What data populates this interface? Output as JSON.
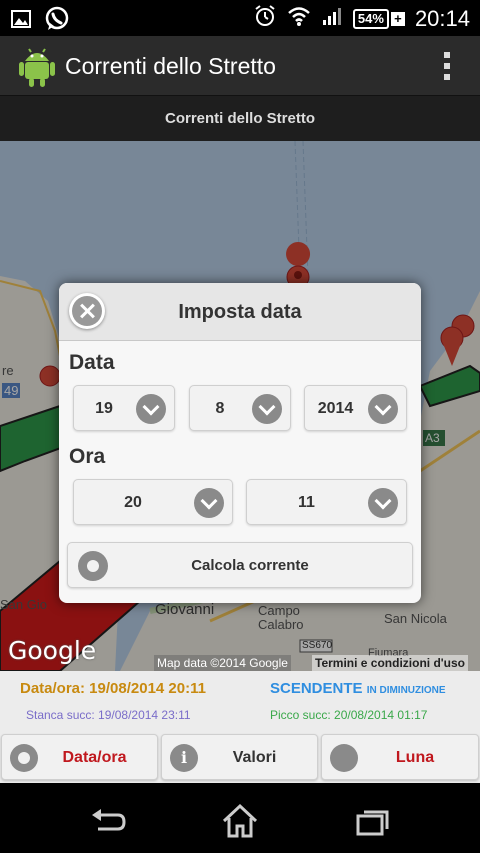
{
  "status_bar": {
    "battery": "54%",
    "battery_plus": "+",
    "time": "20:14",
    "icons": [
      "image-icon",
      "whatsapp-icon",
      "alarm-icon",
      "wifi-icon",
      "signal-icon",
      "battery-icon"
    ]
  },
  "action_bar": {
    "title": "Correnti dello Stretto",
    "subtitle": "Correnti dello Stretto"
  },
  "map": {
    "labels": {
      "re": "re",
      "n49": "49",
      "a3": "A3",
      "giovanni": "Giovanni",
      "campo": "Campo",
      "calabro": "Calabro",
      "san_nicola": "San Nicola",
      "ss670": "SS670",
      "fiumara": "Fiumara",
      "san_gio": "San Gio"
    },
    "google_logo": "Google",
    "map_data": "Map data ©2014 Google",
    "terms": "Termini e condizioni d'uso"
  },
  "dialog": {
    "title": "Imposta data",
    "data_label": "Data",
    "day": "19",
    "month": "8",
    "year": "2014",
    "ora_label": "Ora",
    "hour": "20",
    "minute": "11",
    "calc_button": "Calcola corrente"
  },
  "info": {
    "dataora": "Data/ora: 19/08/2014 20:11",
    "direction": "SCENDENTE",
    "direction_detail": "IN DIMINUZIONE",
    "stanca": "Stanca succ: 19/08/2014 23:11",
    "picco": "Picco succ: 20/08/2014 01:17"
  },
  "buttons": {
    "dataora": "Data/ora",
    "valori": "Valori",
    "luna": "Luna"
  },
  "colors": {
    "dataora_text": "#c88a10",
    "direction": "#2f8ee0",
    "stanca": "#7a6dc9",
    "picco": "#3aa84a",
    "button_red": "#c0181e",
    "current_red": "#d51b1b",
    "current_green": "#2f9a4a"
  }
}
